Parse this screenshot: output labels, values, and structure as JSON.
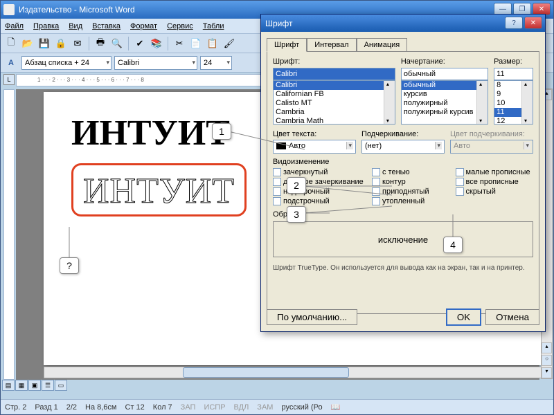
{
  "window": {
    "title": "Издательство - Microsoft Word"
  },
  "menu": [
    "Файл",
    "Правка",
    "Вид",
    "Вставка",
    "Формат",
    "Сервис",
    "Табли"
  ],
  "toolbar2": {
    "style": "Абзац списка + 24",
    "font": "Calibri",
    "size": "24"
  },
  "document": {
    "line1": "ИНТУИТ",
    "line2": "ИНТУИТ"
  },
  "callouts": {
    "q": "?",
    "c1": "1",
    "c2": "2",
    "c3": "3",
    "c4": "4"
  },
  "dialog": {
    "title": "Шрифт",
    "tabs": [
      "Шрифт",
      "Интервал",
      "Анимация"
    ],
    "font_label": "Шрифт:",
    "font_value": "Calibri",
    "font_list": [
      "Calibri",
      "Californian FB",
      "Calisto MT",
      "Cambria",
      "Cambria Math"
    ],
    "style_label": "Начертание:",
    "style_value": "обычный",
    "style_list": [
      "обычный",
      "курсив",
      "полужирный",
      "полужирный курсив"
    ],
    "size_label": "Размер:",
    "size_value": "11",
    "size_list": [
      "8",
      "9",
      "10",
      "11",
      "12"
    ],
    "color_label": "Цвет текста:",
    "color_value": "Авто",
    "underline_label": "Подчеркивание:",
    "underline_value": "(нет)",
    "ucolor_label": "Цвет подчеркивания:",
    "ucolor_value": "Авто",
    "effects_label": "Видоизменение",
    "checks_col1": [
      "зачеркнутый",
      "двойное зачеркивание",
      "надстрочный",
      "подстрочный"
    ],
    "checks_col2": [
      "с тенью",
      "контур",
      "приподнятый",
      "утопленный"
    ],
    "checks_col3": [
      "малые прописные",
      "все прописные",
      "скрытый"
    ],
    "preview_label": "Образец",
    "preview_text": "исключение",
    "tt_note": "Шрифт TrueType. Он используется для вывода как на экран, так и на принтер.",
    "default_btn": "По умолчанию...",
    "ok": "OK",
    "cancel": "Отмена"
  },
  "status": {
    "page": "Стр. 2",
    "section": "Разд 1",
    "pages": "2/2",
    "at": "На 8,6см",
    "line": "Ст 12",
    "col": "Кол 7",
    "ind": [
      "ЗАП",
      "ИСПР",
      "ВДЛ",
      "ЗАМ"
    ],
    "lang": "русский (Ро"
  }
}
